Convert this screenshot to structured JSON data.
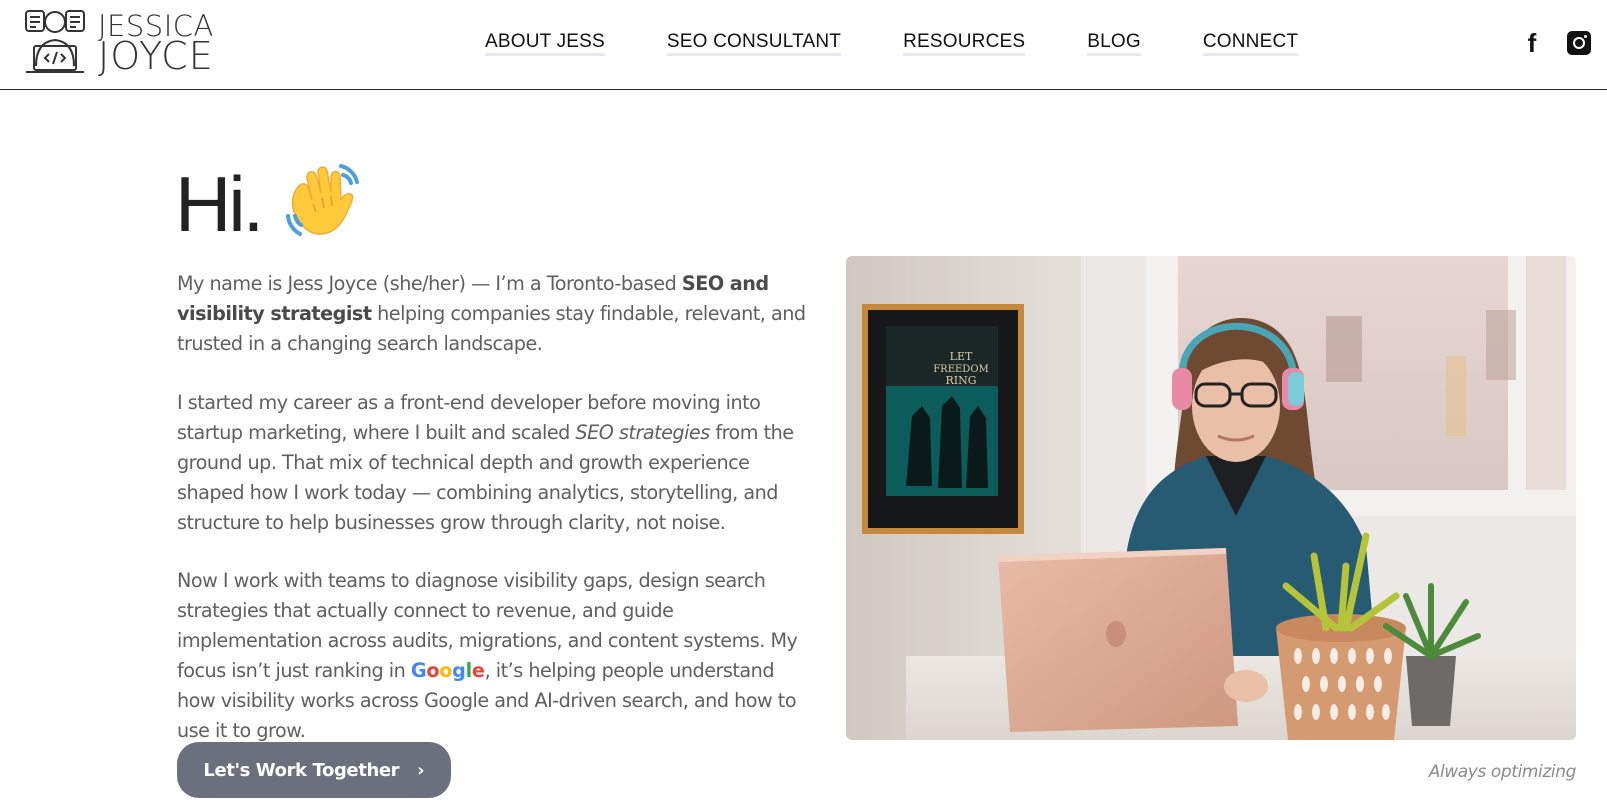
{
  "brand": {
    "name_line1": "JESSICA",
    "name_line2": "JOYCE",
    "logo_icon": "developer-at-laptop-icon"
  },
  "nav": {
    "items": [
      {
        "label": "ABOUT JESS"
      },
      {
        "label": "SEO CONSULTANT"
      },
      {
        "label": "RESOURCES"
      },
      {
        "label": "BLOG"
      },
      {
        "label": "CONNECT"
      }
    ]
  },
  "social": {
    "facebook_glyph": "f",
    "facebook_icon": "facebook-icon",
    "instagram_icon": "instagram-icon"
  },
  "hero": {
    "greeting": "Hi.",
    "greeting_icon": "waving-hand-icon",
    "p1": {
      "text_a": "My name is Jess Joyce (she/her) — I’m a Toronto-based ",
      "bold": "SEO and visibility strategist",
      "text_b": " helping companies stay findable, relevant, and trusted in a changing search landscape."
    },
    "p2": {
      "text_a": "I started my career as a front-end developer before moving into startup marketing, where I built and scaled ",
      "italic": "SEO strategies",
      "text_b": " from the ground up. That mix of technical depth and growth experience shaped how I work today — combining analytics, storytelling, and structure to help businesses grow through clarity, not noise."
    },
    "p3": {
      "text_a": "Now I work with teams to diagnose visibility gaps, design search strategies that actually connect to revenue, and guide implementation across audits, migrations, and content systems. My focus isn’t just ranking in ",
      "google_letters": [
        "G",
        "o",
        "o",
        "g",
        "l",
        "e"
      ],
      "google_colors": [
        "#4285F4",
        "#EA4335",
        "#FBBC05",
        "#4285F4",
        "#34A853",
        "#EA4335"
      ],
      "text_b": ", it’s helping people understand how visibility works across Google and AI-driven search, and how to use it to grow."
    },
    "cta_label": "Let's Work Together",
    "cta_icon": "chevron-right-icon",
    "cta_glyph": "›"
  },
  "photo": {
    "caption": "Always optimizing",
    "poster_text": [
      "LET",
      "FREEDOM",
      "RING"
    ]
  },
  "colors": {
    "cta_bg": "#6c6f7d",
    "body_text": "#5f5f5f",
    "nav_underline": "#ece6f2"
  }
}
